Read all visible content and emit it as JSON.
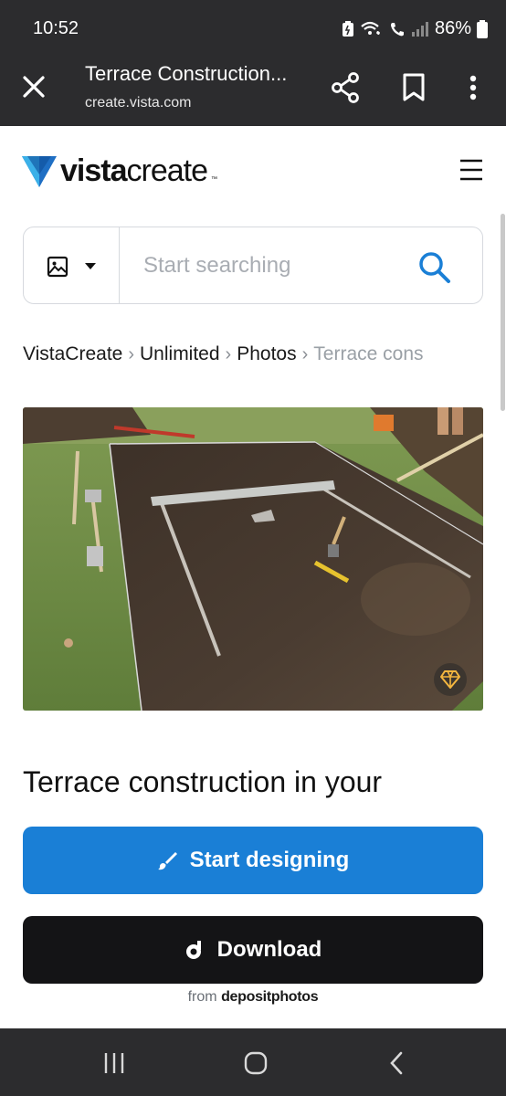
{
  "status_bar": {
    "time": "10:52",
    "battery": "86%",
    "icons": [
      "battery-saver-icon",
      "wifi-calling-icon",
      "signal-icon",
      "battery-icon"
    ]
  },
  "app_bar": {
    "title": "Terrace Construction...",
    "url": "create.vista.com",
    "icons": [
      "close-icon",
      "share-icon",
      "bookmark-icon",
      "more-vert-icon"
    ]
  },
  "header": {
    "logo_text_bold": "vista",
    "logo_text_light": "create",
    "logo_tm": "™",
    "menu_icon": "hamburger-menu-icon"
  },
  "search": {
    "placeholder": "Start searching",
    "value": "",
    "type_icon": "image-icon",
    "button_icon": "search-icon"
  },
  "breadcrumb": {
    "items": [
      "VistaCreate",
      "Unlimited",
      "Photos"
    ],
    "current": "Terrace cons"
  },
  "photo": {
    "alt": "Terrace construction site with excavated soil, tools and string lines",
    "badge_icon": "premium-diamond-icon"
  },
  "headline": "Terrace construction in your",
  "buttons": {
    "design_label": "Start designing",
    "download_label": "Download"
  },
  "from": {
    "prefix": "from",
    "brand": "depositphotos"
  },
  "colors": {
    "accent_blue": "#1a7fd6",
    "dark_button": "#141416",
    "chrome_dark": "#2c2c2e",
    "logo_blue": "#1f6fc4"
  }
}
